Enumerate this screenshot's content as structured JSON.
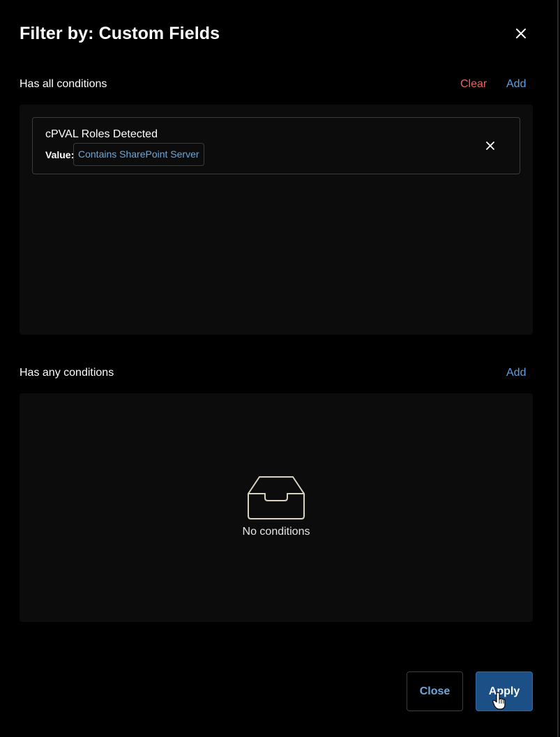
{
  "header": {
    "title": "Filter by: Custom Fields",
    "close_icon": "close-icon"
  },
  "all_conditions": {
    "label": "Has all conditions",
    "clear_label": "Clear",
    "add_label": "Add",
    "items": [
      {
        "name": "cPVAL Roles Detected",
        "value_label": "Value:",
        "value": "Contains SharePoint Server"
      }
    ]
  },
  "any_conditions": {
    "label": "Has any conditions",
    "add_label": "Add",
    "empty_icon": "inbox-tray-icon",
    "empty_text": "No conditions"
  },
  "footer": {
    "close_label": "Close",
    "apply_label": "Apply"
  },
  "colors": {
    "background": "#000000",
    "surface": "#0c0c0c",
    "link_blue": "#5fa0dd",
    "clear_red": "#e5685e",
    "apply_blue": "#1b4f85"
  }
}
